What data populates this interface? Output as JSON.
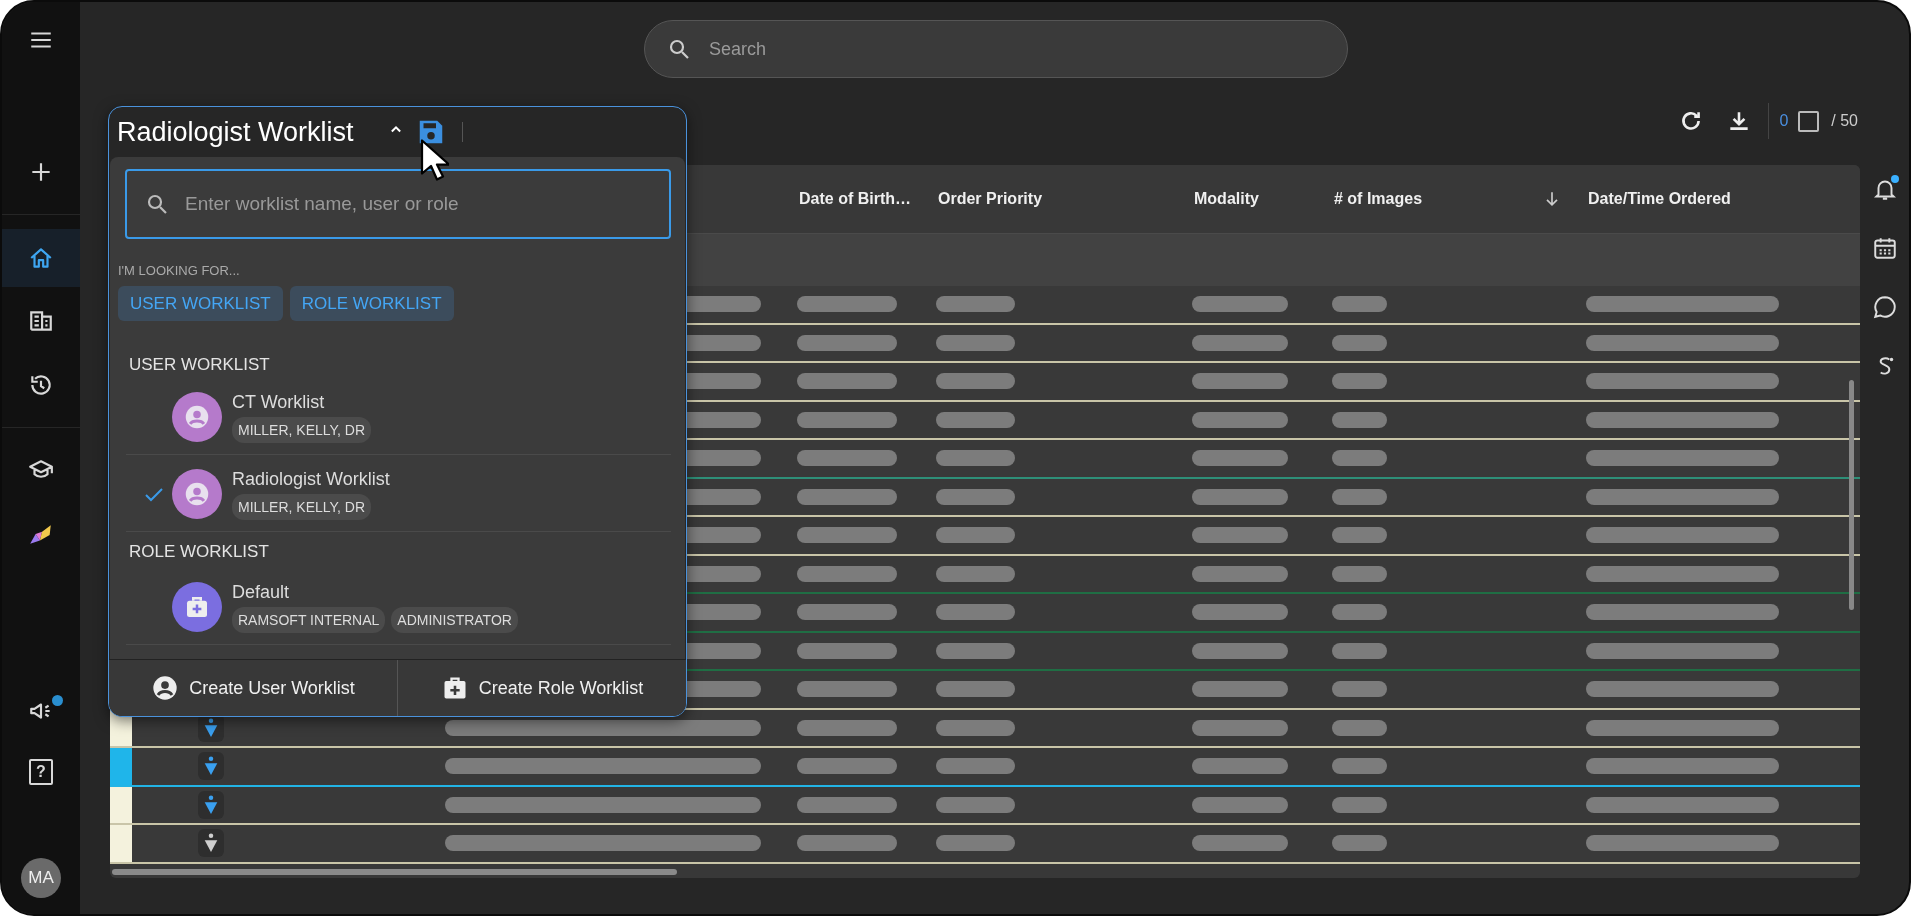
{
  "sidebar": {
    "items": [
      {
        "kind": "menu",
        "selected": false
      },
      {
        "kind": "add",
        "selected": false
      },
      {
        "kind": "home",
        "selected": true
      },
      {
        "kind": "studies",
        "selected": false
      },
      {
        "kind": "history",
        "selected": false
      },
      {
        "kind": "learn",
        "selected": false
      },
      {
        "kind": "analytics",
        "selected": false
      },
      {
        "kind": "announcements",
        "selected": false,
        "badge": true
      },
      {
        "kind": "help",
        "selected": false,
        "glyph": "?"
      }
    ],
    "avatar": "MA"
  },
  "search": {
    "placeholder": "Search"
  },
  "worklist_picker": {
    "title": "Radiologist Worklist",
    "expanded": true,
    "search_placeholder": "Enter worklist name, user or role",
    "filter_label": "I'M LOOKING FOR...",
    "filters": [
      {
        "label": "USER WORKLIST"
      },
      {
        "label": "ROLE WORKLIST"
      }
    ],
    "groups": [
      {
        "heading": "USER WORKLIST",
        "items": [
          {
            "kind": "user",
            "name": "CT Worklist",
            "tags": [
              "MILLER, KELLY, DR"
            ],
            "selected": false
          },
          {
            "kind": "user",
            "name": "Radiologist Worklist",
            "tags": [
              "MILLER, KELLY, DR"
            ],
            "selected": true
          }
        ]
      },
      {
        "heading": "ROLE WORKLIST",
        "items": [
          {
            "kind": "role",
            "name": "Default",
            "tags": [
              "RAMSOFT INTERNAL",
              "ADMINISTRATOR"
            ],
            "selected": false
          }
        ]
      }
    ],
    "actions": [
      {
        "kind": "user",
        "label": "Create User Worklist"
      },
      {
        "kind": "role",
        "label": "Create Role Worklist"
      }
    ]
  },
  "toolbar": {
    "selected_count": "0",
    "all_checked": false,
    "page_size": "/ 50"
  },
  "table": {
    "columns": [
      {
        "label": "Date of Birth…",
        "sorted": false
      },
      {
        "label": "Order Priority",
        "sorted": false
      },
      {
        "label": "Modality",
        "sorted": false
      },
      {
        "label": "# of Images",
        "sorted": true
      },
      {
        "label": "Date/Time Ordered",
        "sorted": false
      }
    ],
    "rows": [
      {
        "color": "#c9c5a8"
      },
      {
        "color": "#c9c5a8"
      },
      {
        "color": "#c9c5a8"
      },
      {
        "color": "#c9c5a8"
      },
      {
        "color": "#2e8f78"
      },
      {
        "color": "#c9c5a8"
      },
      {
        "color": "#c9c5a8"
      },
      {
        "color": "#1f6e44"
      },
      {
        "color": "#1f6e44"
      },
      {
        "color": "#1f6e44"
      },
      {
        "color": "#c9c5a8"
      },
      {
        "color": "#c9c5a8",
        "highlighted": false,
        "kind": "active"
      },
      {
        "color": "#22b4e6",
        "highlighted": true,
        "kind": "active"
      },
      {
        "color": "#c9c5a8",
        "highlighted": false,
        "kind": "active"
      },
      {
        "color": "#c9c5a8",
        "highlighted": false,
        "kind": "inactive"
      }
    ]
  },
  "right_rail": [
    {
      "kind": "notifications",
      "badge": true
    },
    {
      "kind": "calendar",
      "badge": false
    },
    {
      "kind": "chat",
      "badge": false
    },
    {
      "kind": "signature",
      "badge": false
    }
  ]
}
